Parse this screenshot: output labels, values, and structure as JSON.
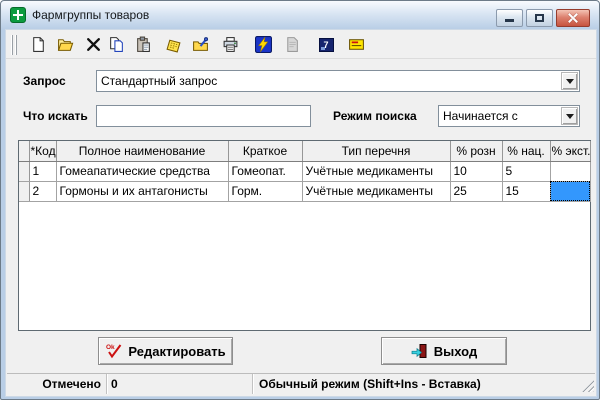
{
  "window": {
    "title": "Фармгруппы товаров"
  },
  "toolbar": {
    "icons": [
      "new-document",
      "open-folder",
      "delete",
      "copy",
      "paste",
      "memo",
      "folder-edit",
      "print",
      "execute-query",
      "print-preview-disabled",
      "key-7",
      "mail"
    ],
    "key7_glyph": "7"
  },
  "query": {
    "label": "Запрос",
    "value": "Стандартный запрос",
    "find_label": "Что искать",
    "find_value": "",
    "mode_label": "Режим поиска",
    "mode_value": "Начинается с"
  },
  "table": {
    "columns": [
      "*Код",
      "Полное наименование",
      "Краткое",
      "Тип перечня",
      "% розн",
      "% нац.",
      "% экст."
    ],
    "rows": [
      [
        "1",
        "Гомеапатические средства",
        "Гомеопат.",
        "Учётные медикаменты",
        "10",
        "5",
        ""
      ],
      [
        "2",
        "Гормоны и их антагонисты",
        "Горм.",
        "Учётные медикаменты",
        "25",
        "15",
        ""
      ]
    ]
  },
  "actions": {
    "edit": "Редактировать",
    "edit_badge": "Ok",
    "exit": "Выход"
  },
  "statusbar": {
    "marked_label": "Отмечено",
    "marked_value": "0",
    "mode_text": "Обычный режим (Shift+Ins - Вставка)"
  },
  "colors": {
    "selection": "#3397fd",
    "frame": "#b9cee6",
    "exec_icon_bg": "#1b35c8",
    "lightning": "#ffd800"
  }
}
